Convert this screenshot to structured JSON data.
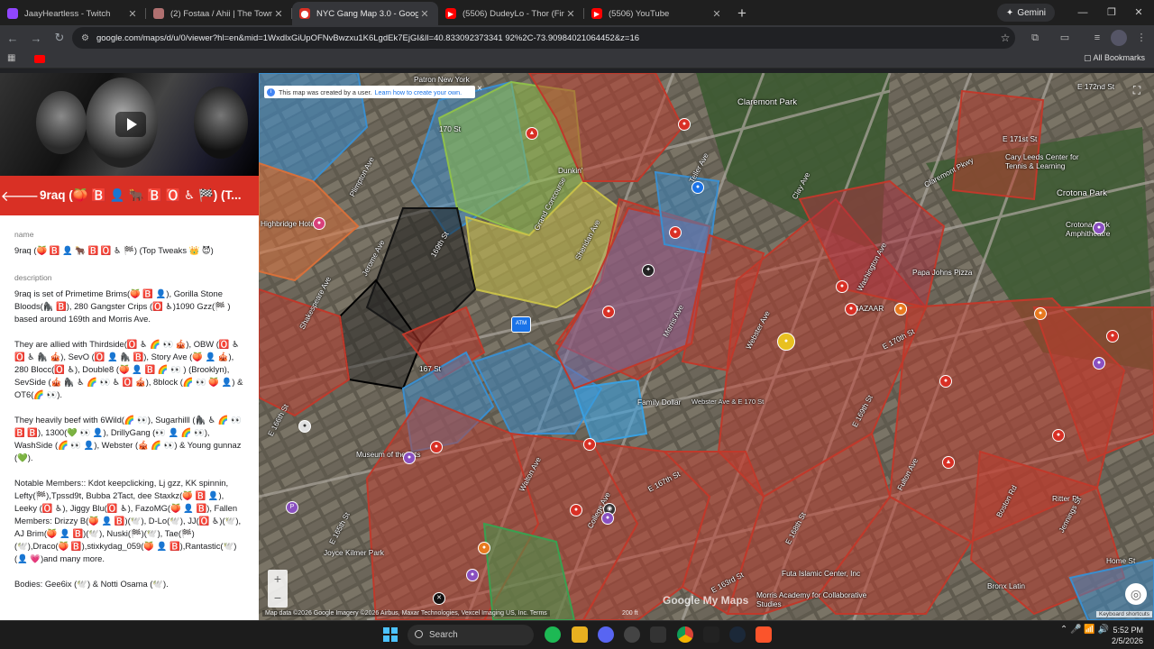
{
  "tabs": [
    {
      "title": "JaayHeartless - Twitch",
      "favicon": "twitch-icon",
      "color": "#9146ff",
      "active": false
    },
    {
      "title": "(2) Fostaa / Ahii | The Towns Ro",
      "favicon": "generic-icon",
      "color": "#b07070",
      "active": false
    },
    {
      "title": "NYC Gang Map 3.0 - Google M",
      "favicon": "maps-icon",
      "color": "#d93025",
      "active": true
    },
    {
      "title": "(5506) DudeyLo - Thor (First Da",
      "favicon": "youtube-icon",
      "color": "#ff0000",
      "active": false
    },
    {
      "title": "(5506) YouTube",
      "favicon": "youtube-icon",
      "color": "#ff0000",
      "active": false
    }
  ],
  "gemini_label": "Gemini",
  "url": "google.com/maps/d/u/0/viewer?hl=en&mid=1WxdlxGiUpOFNvBwzxu1K6LgdEk7EjGI&ll=40.833092373341 92%2C-73.90984021064452&z=16",
  "bookmarks": {
    "all_label": "All Bookmarks"
  },
  "panel": {
    "title": "9raq (🍑 🅱️ 👤 🐂 🅱️ 🅾️ ♿ 🏁) (T...",
    "name_label": "name",
    "name_value": "9raq (🍑 🅱️ 👤 🐂 🅱️ 🅾️ ♿ 🏁) (Top Tweaks 👑 😈)",
    "description_label": "description",
    "desc_p1": "9raq is set of Primetime Brims(🍑 🅱️ 👤), Gorilla Stone Bloods(🦍 🅱️), 280 Gangster Crips (🅾️ ♿)1090 Gzz(🏁 ) based around 169th and Morris Ave.",
    "desc_p2": "They are allied with Thirdside(🅾️ ♿ 🌈 👀 🎪), OBW (🅾️ ♿ 🅾️ ♿ 🦍 🎪), SevO (🅾️ 👤 🦍 🅱️), Story Ave (🍑 👤 🎪), 280 Blocc(🅾️ ♿), Double8 (🍑 👤 🅱️ 🌈 👀 ) (Brooklyn), SevSide (🎪 🦍 ♿ 🌈 👀 ♿ 🅾️ 🎪), 8block (🌈 👀 🍑 👤) & OT6(🌈 👀).",
    "desc_p3": "They heavily beef with 6Wild(🌈 👀), Sugarhilll (🦍 ♿ 🌈 👀 🅱️ 🅱️), 1300(💚 👀 👤), DrillyGang (👀 👤 🌈 👀), WashSide (🌈 👀 👤), Webster (🎪 🌈 👀) & Young gunnaz (💚).",
    "desc_p4": "Notable Members:: Kdot keepclicking, Lj gzz, KK spinnin, Lefty(🏁),Tpssd9t, Bubba 2Tact, dee Staxkz(🍑 🅱️ 👤), Leeky (🅾️ ♿), Jiggy Blu(🅾️ ♿), FazoMG(🍑 👤 🅱️), Fallen Members: Drizzy B(🍑 👤 🅱️)(🕊️), D-Lo(🕊️), JJ(🅾️ ♿)(🕊️), AJ Brim(🍑 👤 🅱️)(🕊️), Nuski(🏁)(🕊️), Tae(🏁)(🕊️),Draco(🍑 🅱️),stixkydag_059(🍑 👤 🅱️),Rantastic(🕊️)(👤 💗)and many more.",
    "desc_p5": "Bodies: Gee6ix (🕊️) & Notti Osama (🕊️)."
  },
  "map": {
    "notice_text": "This map was created by a user.",
    "notice_link": "Learn how to create your own.",
    "attribution": "Map data ©2026 Google Imagery ©2026 Airbus, Maxar Technologies, Vexcel Imaging US, Inc.",
    "terms": "Terms",
    "scale": "200 ft",
    "keyboard": "Keyboard shortcuts",
    "logo": "Google My Maps",
    "labels": [
      "Patron New York",
      "Grand Concourse",
      "Claremont Park",
      "E 172nd St",
      "E 171st St",
      "170 St",
      "Dunkin'",
      "Jerome Ave",
      "Plimpton Ave",
      "Highbridge Hotel",
      "Shakespeare Ave",
      "167 St",
      "169th St",
      "Walton Ave",
      "Sheridan Ave",
      "Morris Ave",
      "Teller Ave",
      "Clay Ave",
      "Webster Ave",
      "College Ave",
      "Washington Ave",
      "Claremont Pkwy",
      "Crotona Park",
      "Crotona Park Amphitheatre",
      "Cary Leeds Center for Tennis & Learning",
      "Papa Johns Pizza",
      "BAZAAR",
      "E 170th St",
      "E 169th St",
      "E 168th St",
      "E 167th St",
      "E 166th St",
      "E 165th St",
      "E 163rd St",
      "Morris Academy for Collaborative Studies",
      "Futa Islamic Center, Inc",
      "Boston Rd",
      "Fulton Ave",
      "Bronx Latin",
      "Home St",
      "Ritter Pl",
      "Jennings St",
      "Museum of the Arts",
      "Joyce Kilmer Park",
      "Family Dollar",
      "Webster Ave & E 170 St"
    ]
  },
  "taskbar": {
    "search_label": "Search",
    "time": "5:52 PM",
    "date": "2/5/2026"
  }
}
